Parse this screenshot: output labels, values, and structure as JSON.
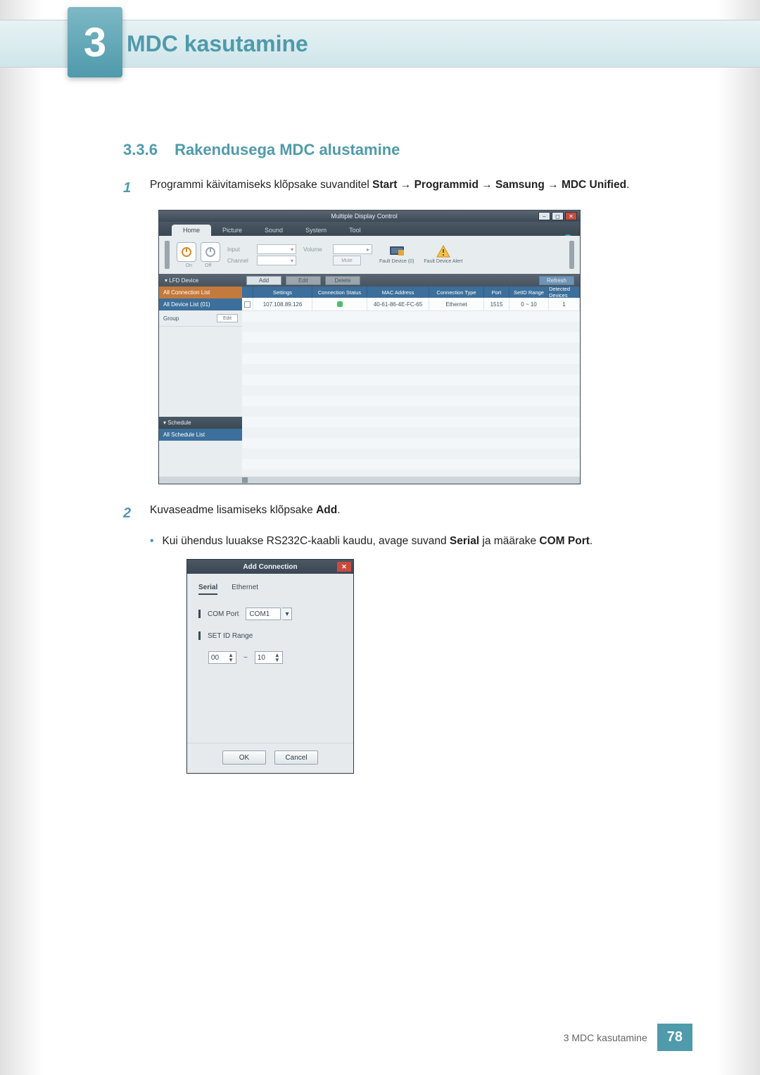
{
  "chapter": {
    "number": "3",
    "title": "MDC kasutamine"
  },
  "section": {
    "number": "3.3.6",
    "title": "Rakendusega MDC alustamine"
  },
  "steps": {
    "s1_num": "1",
    "s1_pre": "Programmi käivitamiseks klõpsake suvanditel ",
    "s1_b1": "Start",
    "s1_arr1": " → ",
    "s1_b2": "Programmid",
    "s1_arr2": " → ",
    "s1_b3": "Samsung",
    "s1_arr3": " → ",
    "s1_b4": "MDC Unified",
    "s1_post": ".",
    "s2_num": "2",
    "s2_pre": "Kuvaseadme lisamiseks klõpsake ",
    "s2_b": "Add",
    "s2_post": ".",
    "bullet_pre": "Kui ühendus luuakse RS232C-kaabli kaudu, avage suvand ",
    "bullet_b1": "Serial",
    "bullet_mid": " ja määrake ",
    "bullet_b2": "COM Port",
    "bullet_post": "."
  },
  "mdc": {
    "title": "Multiple Display Control",
    "help": "?",
    "menubar": [
      "Home",
      "Picture",
      "Sound",
      "System",
      "Tool"
    ],
    "toolbar": {
      "input_label": "Input",
      "channel_label": "Channel",
      "volume_label": "Volume",
      "mute_btn": "Mute",
      "fault0": "Fault Device (0)",
      "fault_alert": "Fault Device Alert"
    },
    "actions": {
      "side_label": "▾  LFD Device",
      "add": "Add",
      "edit": "Edit",
      "delete": "Delete",
      "refresh": "Refresh"
    },
    "side": {
      "all_conn": "All Connection List",
      "all_dev": "All Device List (01)",
      "group": "Group",
      "edit_btn": "Edit",
      "schedule_head": "▾  Schedule",
      "all_sched": "All Schedule List"
    },
    "grid": {
      "headers": [
        "",
        "Settings",
        "Connection Status",
        "MAC Address",
        "Connection Type",
        "Port",
        "SetID Range",
        "Detected Devices"
      ],
      "row": {
        "settings": "107.108.89.126",
        "mac": "40-61-86-4E-FC-65",
        "ctype": "Ethernet",
        "port": "1515",
        "range": "0 ~ 10",
        "detected": "1"
      }
    }
  },
  "dlg": {
    "title": "Add Connection",
    "tabs": [
      "Serial",
      "Ethernet"
    ],
    "com_label": "COM Port",
    "com_value": "COM1",
    "range_label": "SET ID Range",
    "range_from": "00",
    "range_sep": "~",
    "range_to": "10",
    "ok": "OK",
    "cancel": "Cancel"
  },
  "footer": {
    "text": "3 MDC kasutamine",
    "page": "78"
  }
}
